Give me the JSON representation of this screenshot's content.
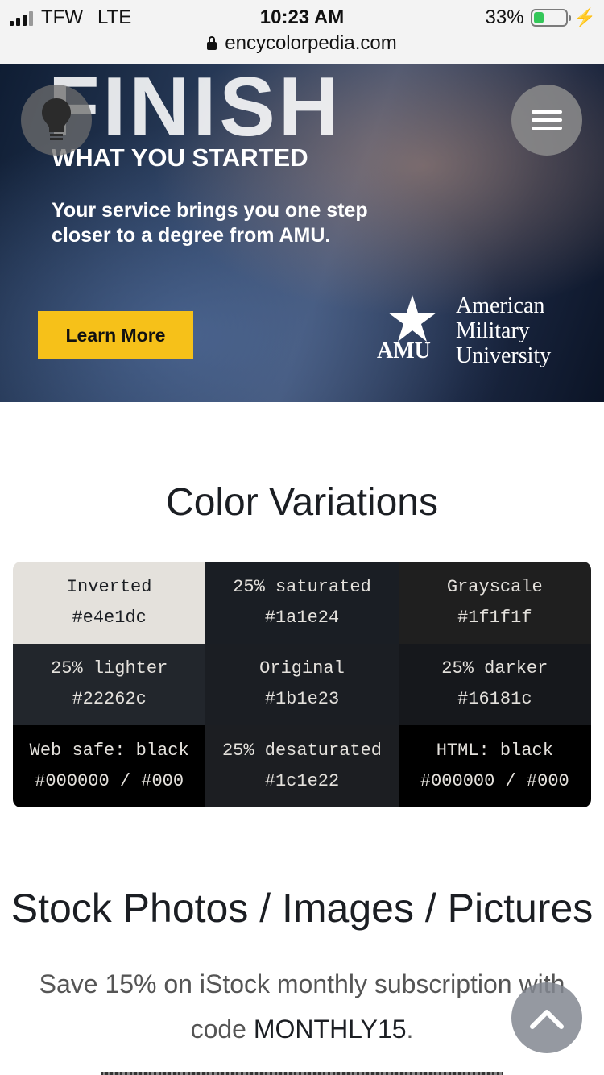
{
  "status_bar": {
    "carrier": "TFW",
    "network": "LTE",
    "time": "10:23 AM",
    "battery_percent": "33%",
    "battery_level": 0.33,
    "url": "encycolorpedia.com"
  },
  "ad": {
    "headline": "FINISH",
    "subheadline": "WHAT YOU STARTED",
    "body": "Your service brings you one step closer to a degree from AMU.",
    "cta_label": "Learn More",
    "logo_abbr": "AMU",
    "logo_name_line1": "American",
    "logo_name_line2": "Military",
    "logo_name_line3": "University"
  },
  "icons": {
    "bulb": "lightbulb-icon",
    "menu": "hamburger-menu-icon",
    "up": "chevron-up-icon",
    "lock": "lock-icon"
  },
  "color_variations": {
    "title": "Color Variations",
    "cells": [
      {
        "label": "Inverted",
        "hex": "#e4e1dc",
        "bg": "#e4e1dc",
        "fg": "#1b1e23"
      },
      {
        "label": "25% saturated",
        "hex": "#1a1e24",
        "bg": "#1a1e24",
        "fg": "#e4e1dc"
      },
      {
        "label": "Grayscale",
        "hex": "#1f1f1f",
        "bg": "#1f1f1f",
        "fg": "#e4e1dc"
      },
      {
        "label": "25% lighter",
        "hex": "#22262c",
        "bg": "#22262c",
        "fg": "#e4e1dc"
      },
      {
        "label": "Original",
        "hex": "#1b1e23",
        "bg": "#1b1e23",
        "fg": "#e4e1dc"
      },
      {
        "label": "25% darker",
        "hex": "#16181c",
        "bg": "#16181c",
        "fg": "#e4e1dc"
      },
      {
        "label": "Web safe: black",
        "hex": "#000000 / #000",
        "bg": "#000000",
        "fg": "#e4e1dc"
      },
      {
        "label": "25% desaturated",
        "hex": "#1c1e22",
        "bg": "#1c1e22",
        "fg": "#e4e1dc"
      },
      {
        "label": "HTML: black",
        "hex": "#000000 / #000",
        "bg": "#000000",
        "fg": "#e4e1dc"
      }
    ]
  },
  "stock_photos": {
    "title": "Stock Photos / Images / Pictures",
    "text_before": "Save 15% on iStock monthly subscription with code ",
    "code": "MONTHLY15",
    "text_after": "."
  }
}
